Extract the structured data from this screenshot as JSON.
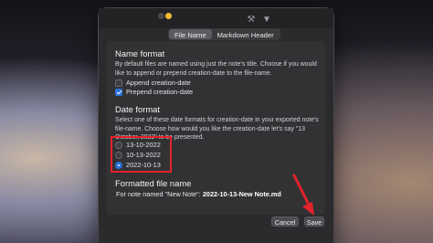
{
  "tabs": {
    "file_name": "File Name",
    "markdown_header": "Markdown Header"
  },
  "name_format": {
    "heading": "Name format",
    "description": "By default files are named using just the note's title. Choose if you would like to append or prepend creation-date to the file-name.",
    "append_label": "Append creation-date",
    "append_checked": false,
    "prepend_label": "Prepend creation-date",
    "prepend_checked": true
  },
  "date_format": {
    "heading": "Date format",
    "description": "Select one of these date formats for creation-date in your exported note's file-name. Choose how would you like the creation-date let's say \"13 October, 2022\" to be presented.",
    "options": [
      "13-10-2022",
      "10-13-2022",
      "2022-10-13"
    ],
    "selected": "2022-10-13"
  },
  "formatted": {
    "heading": "Formatted file name",
    "prefix": "For note named \"New Note\":",
    "value": "2022-10-13-New Note.md"
  },
  "buttons": {
    "cancel": "Cancel",
    "save": "Save"
  },
  "colors": {
    "accent": "#2a73d9",
    "annotation_red": "#e3222a",
    "window_bg": "#2b2b2e"
  },
  "icons": [
    "wrench-icon",
    "funnel-icon"
  ]
}
